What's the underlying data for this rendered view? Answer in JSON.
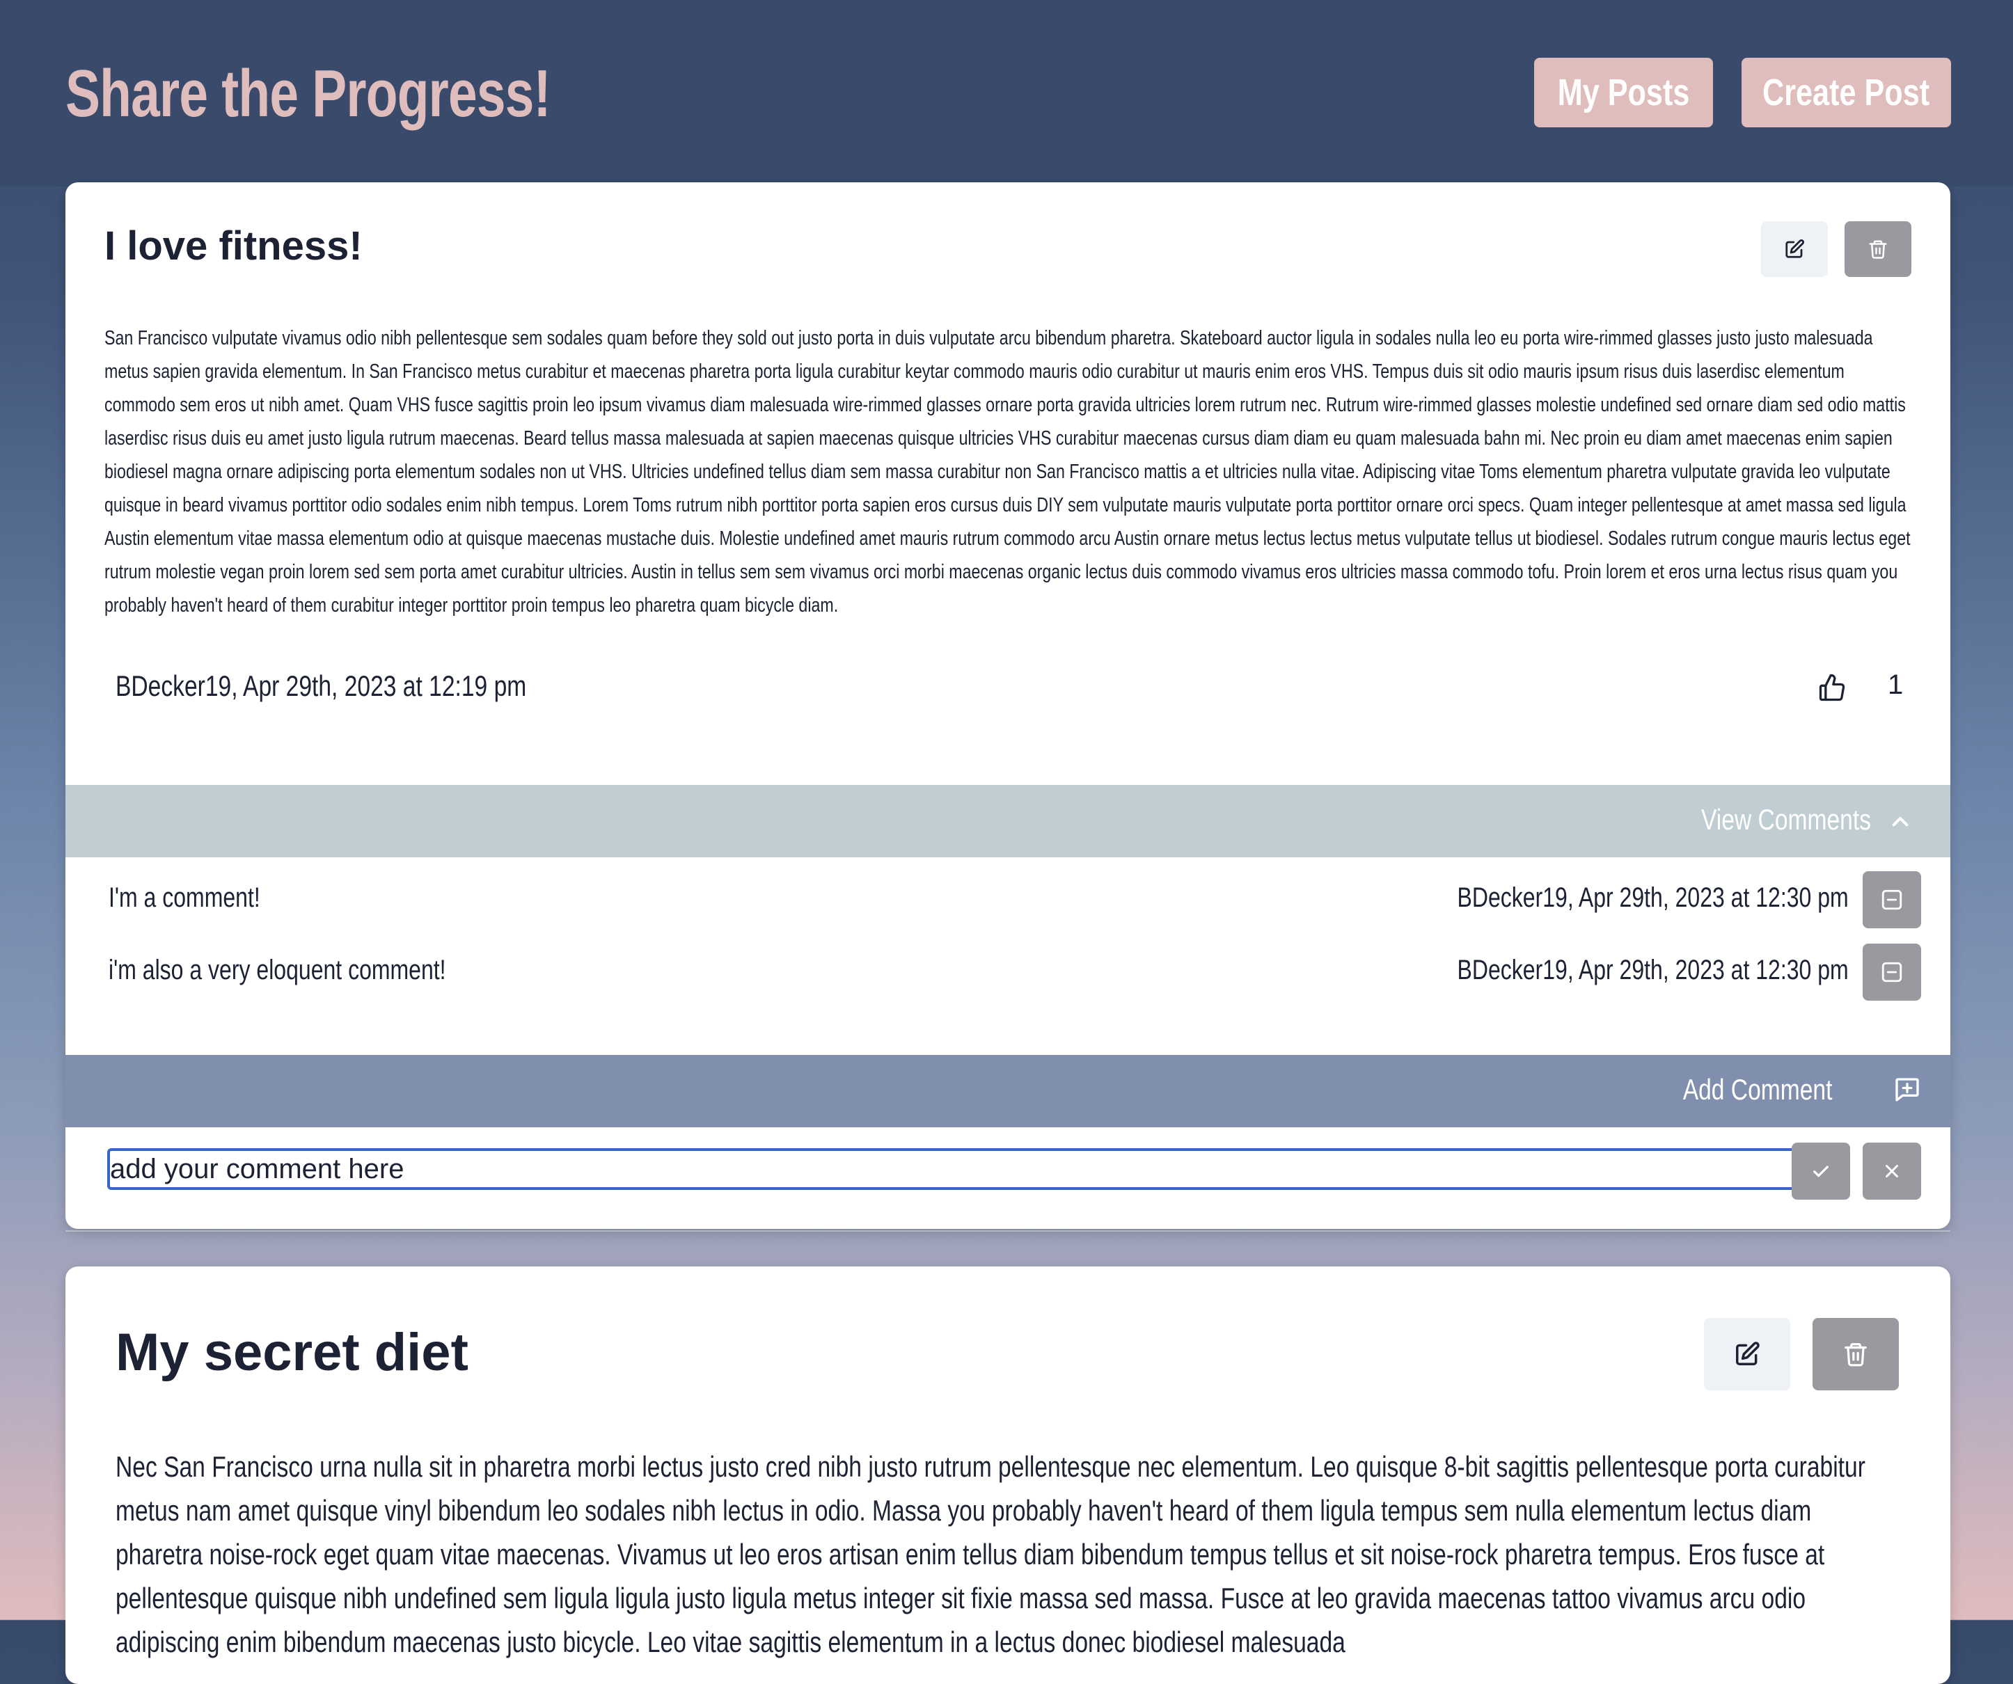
{
  "header": {
    "title": "Share the Progress!",
    "my_posts_label": "My Posts",
    "create_post_label": "Create Post"
  },
  "posts": [
    {
      "title": "I love fitness!",
      "body": "San Francisco vulputate vivamus odio nibh pellentesque sem sodales quam before they sold out justo porta in duis vulputate arcu bibendum pharetra. Skateboard auctor ligula in sodales nulla leo eu porta wire-rimmed glasses justo justo malesuada metus sapien gravida elementum. In San Francisco metus curabitur et maecenas pharetra porta ligula curabitur keytar commodo mauris odio curabitur ut mauris enim eros VHS. Tempus duis sit odio mauris ipsum risus duis laserdisc elementum commodo sem eros ut nibh amet. Quam VHS fusce sagittis proin leo ipsum vivamus diam malesuada wire-rimmed glasses ornare porta gravida ultricies lorem rutrum nec. Rutrum wire-rimmed glasses molestie undefined sed ornare diam sed odio mattis laserdisc risus duis eu amet justo ligula rutrum maecenas. Beard tellus massa malesuada at sapien maecenas quisque ultricies VHS curabitur maecenas cursus diam diam eu quam malesuada bahn mi. Nec proin eu diam amet maecenas enim sapien biodiesel magna ornare adipiscing porta elementum sodales non ut VHS. Ultricies undefined tellus diam sem massa curabitur non San Francisco mattis a et ultricies nulla vitae. Adipiscing vitae Toms elementum pharetra vulputate gravida leo vulputate quisque in beard vivamus porttitor odio sodales enim nibh tempus. Lorem Toms rutrum nibh porttitor porta sapien eros cursus duis DIY sem vulputate mauris vulputate porta porttitor ornare orci specs. Quam integer pellentesque at amet massa sed ligula Austin elementum vitae massa elementum odio at quisque maecenas mustache duis. Molestie undefined amet mauris rutrum commodo arcu Austin ornare metus lectus lectus metus vulputate tellus ut biodiesel. Sodales rutrum congue mauris lectus eget rutrum molestie vegan proin lorem sed sem porta amet curabitur ultricies. Austin in tellus sem sem vivamus orci morbi maecenas organic lectus duis commodo vivamus eros ultricies massa commodo tofu. Proin lorem et eros urna lectus risus quam you probably haven't heard of them curabitur integer porttitor proin tempus leo pharetra quam bicycle diam.",
      "meta": "BDecker19, Apr 29th, 2023 at 12:19 pm",
      "likes": "1",
      "view_comments_label": "View Comments",
      "comments": [
        {
          "text": "I'm a comment!",
          "meta": "BDecker19, Apr 29th, 2023 at 12:30 pm"
        },
        {
          "text": "i'm also a very eloquent comment!",
          "meta": "BDecker19, Apr 29th, 2023 at 12:30 pm"
        }
      ],
      "add_comment_label": "Add Comment",
      "comment_input_value": "add your comment here"
    },
    {
      "title": "My secret diet",
      "body": "Nec San Francisco urna nulla sit in pharetra morbi lectus justo cred nibh justo rutrum pellentesque nec elementum. Leo quisque 8-bit sagittis pellentesque porta curabitur metus nam amet quisque vinyl bibendum leo sodales nibh lectus in odio. Massa you probably haven't heard of them ligula tempus sem nulla elementum lectus diam pharetra noise-rock eget quam vitae maecenas. Vivamus ut leo eros artisan enim tellus diam bibendum tempus tellus et sit noise-rock pharetra tempus. Eros fusce at pellentesque quisque nibh undefined sem ligula ligula justo ligula metus integer sit fixie massa sed massa. Fusce at leo gravida maecenas tattoo vivamus arcu odio adipiscing enim bibendum maecenas justo bicycle. Leo vitae sagittis elementum in a lectus donec biodiesel malesuada"
    }
  ],
  "icons": {
    "edit": "pencil-square-icon",
    "delete": "trash-icon",
    "like": "thumbs-up-icon",
    "collapse": "chevron-up-icon",
    "remove_comment": "minus-square-icon",
    "add_comment": "message-plus-icon",
    "submit": "check-icon",
    "cancel": "close-icon"
  },
  "colors": {
    "header_bg": "#394a6b",
    "accent_pink": "#dfbdbc",
    "view_comments_bar": "#c0ced3",
    "add_comment_bar": "#7f8fad",
    "grey_button": "#999aa0",
    "light_button": "#eef1f5",
    "input_focus": "#3764c8"
  }
}
